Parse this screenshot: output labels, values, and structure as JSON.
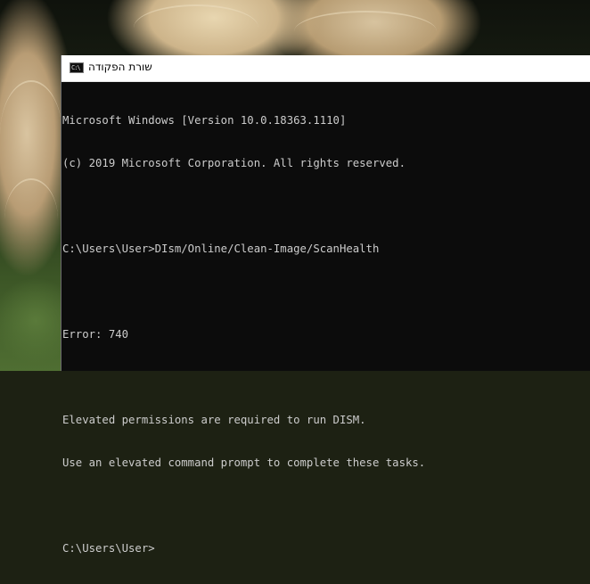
{
  "window": {
    "title": "שורת הפקודה",
    "icon": "cmd-icon",
    "icon_glyph": "C:\\"
  },
  "console": {
    "lines": [
      "Microsoft Windows [Version 10.0.18363.1110]",
      "(c) 2019 Microsoft Corporation. All rights reserved.",
      "",
      "C:\\Users\\User>DIsm/Online/Clean-Image/ScanHealth",
      "",
      "Error: 740",
      "",
      "Elevated permissions are required to run DISM.",
      "Use an elevated command prompt to complete these tasks.",
      "",
      "C:\\Users\\User>"
    ]
  },
  "colors": {
    "console_background": "#0c0c0c",
    "console_text": "#cccccc",
    "title_bar": "#ffffff"
  }
}
